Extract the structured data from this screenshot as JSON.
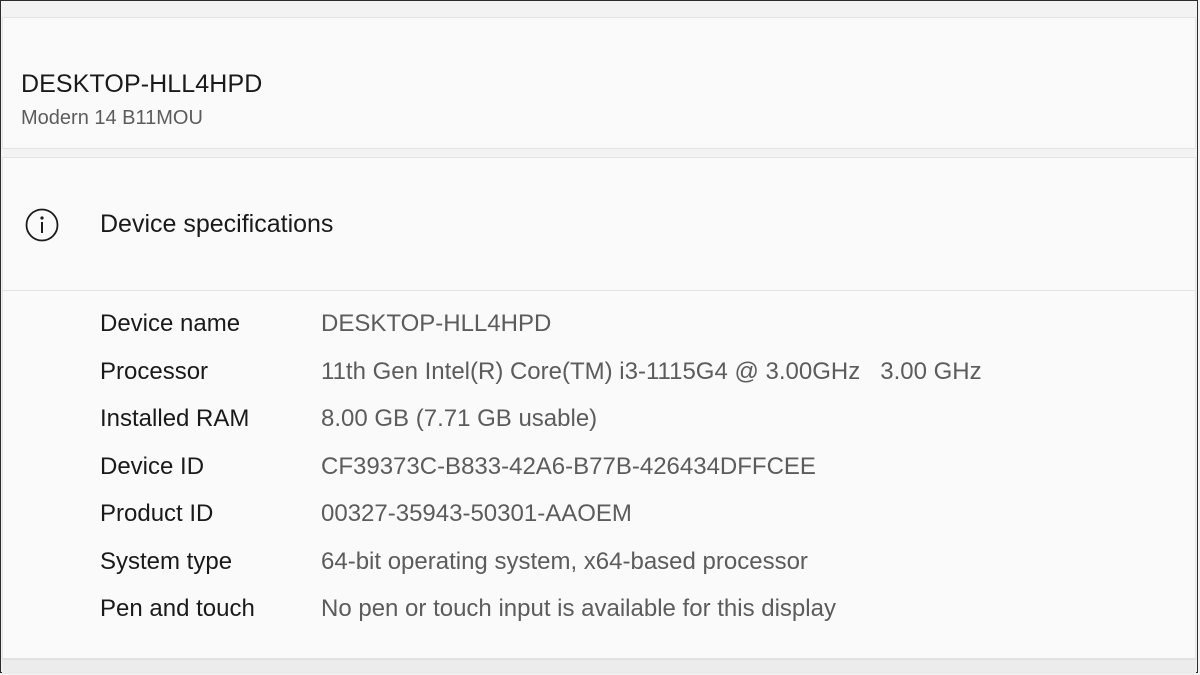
{
  "device": {
    "name": "DESKTOP-HLL4HPD",
    "model": "Modern 14 B11MOU"
  },
  "specs": {
    "icon": "info-icon",
    "title": "Device specifications",
    "rows": [
      {
        "label": "Device name",
        "value": "DESKTOP-HLL4HPD"
      },
      {
        "label": "Processor",
        "value": "11th Gen Intel(R) Core(TM) i3-1115G4 @ 3.00GHz   3.00 GHz"
      },
      {
        "label": "Installed RAM",
        "value": "8.00 GB (7.71 GB usable)"
      },
      {
        "label": "Device ID",
        "value": "CF39373C-B833-42A6-B77B-426434DFFCEE"
      },
      {
        "label": "Product ID",
        "value": "00327-35943-50301-AAOEM"
      },
      {
        "label": "System type",
        "value": "64-bit operating system, x64-based processor"
      },
      {
        "label": "Pen and touch",
        "value": "No pen or touch input is available for this display"
      }
    ]
  }
}
